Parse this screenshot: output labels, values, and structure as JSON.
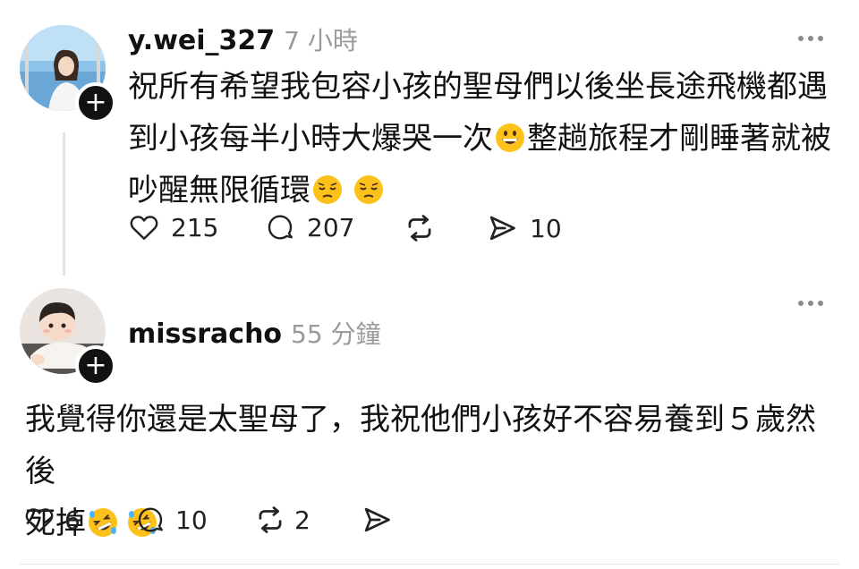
{
  "post1": {
    "username": "y.wei_327",
    "time": "7 小時",
    "lines": [
      "祝所有希望我包容小孩的聖母們以後坐長途飛機都遇",
      "到小孩每半小時大爆哭一次",
      "整趟旅程才剛睡著就被",
      "吵醒無限循環"
    ],
    "likes": "215",
    "comments": "207",
    "shares": "10"
  },
  "post2": {
    "username": "missracho",
    "time": "55 分鐘",
    "lines": [
      "我覺得你還是太聖母了，我祝他們小孩好不容易養到５歲然後",
      "死掉"
    ],
    "likes": "6",
    "comments": "10",
    "reposts": "2"
  }
}
